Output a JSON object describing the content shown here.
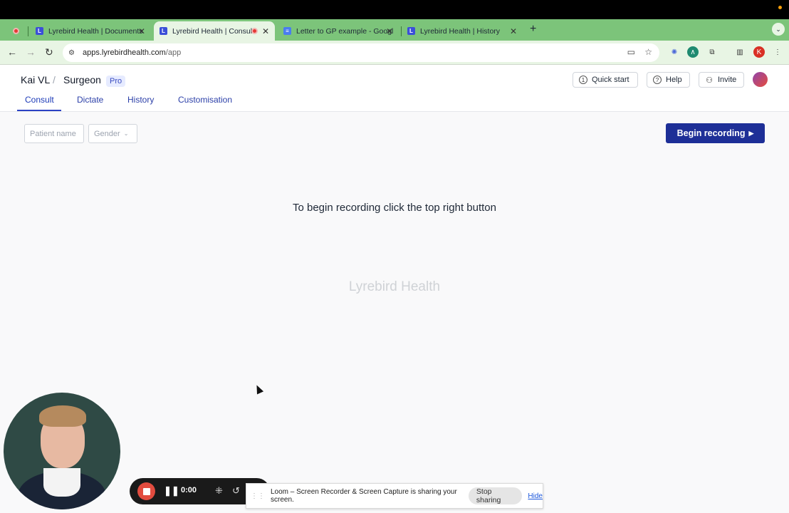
{
  "browser": {
    "tabs": [
      {
        "title": "Lyrebird Health | Documents",
        "favicon": "L"
      },
      {
        "title": "Lyrebird Health | Consult",
        "favicon": "L"
      },
      {
        "title": "Letter to GP example - Googl",
        "favicon": "doc-icon"
      },
      {
        "title": "Lyrebird Health | History",
        "favicon": "L"
      }
    ],
    "url_host": "apps.lyrebirdhealth.com",
    "url_path": "/app",
    "profile_initial": "K"
  },
  "header": {
    "workspace": "Kai VL",
    "separator": "/",
    "role": "Surgeon",
    "plan_badge": "Pro",
    "nav": [
      "Consult",
      "Dictate",
      "History",
      "Customisation"
    ],
    "quick_start": "Quick start",
    "help": "Help",
    "invite": "Invite"
  },
  "form": {
    "patient_placeholder": "Patient name",
    "gender_placeholder": "Gender",
    "begin_button": "Begin recording"
  },
  "main": {
    "instruction": "To begin recording click the top right button",
    "watermark": "Lyrebird Health"
  },
  "loom": {
    "timer": "0:00",
    "share_message": "Loom – Screen Recorder & Screen Capture is sharing your screen.",
    "stop_sharing": "Stop sharing",
    "hide": "Hide"
  },
  "colors": {
    "tabstrip": "#7cc47a",
    "primary_button": "#1e2f97",
    "record_red": "#e24c3f"
  }
}
